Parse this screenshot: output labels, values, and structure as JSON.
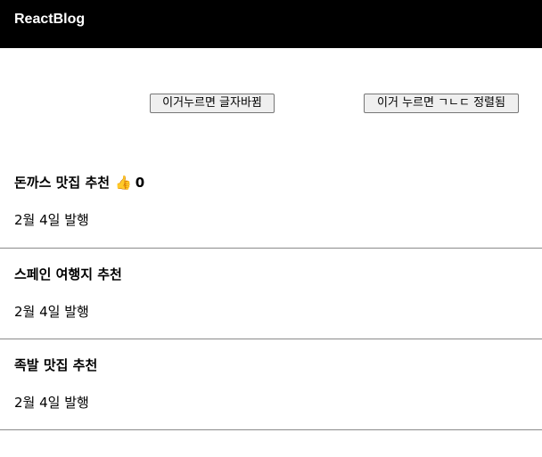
{
  "header": {
    "brand": "ReactBlog"
  },
  "controls": {
    "change_text_button": "이거누르면 글자바뀜",
    "sort_button": "이거 누르면 ㄱㄴㄷ 정렬됨"
  },
  "posts": [
    {
      "title": "돈까스 맛집 추천",
      "like_icon": "thumbs-up-icon",
      "likes": "0",
      "date": "2월 4일 발행"
    },
    {
      "title": "스페인 여행지 추천",
      "date": "2월 4일 발행"
    },
    {
      "title": "족발 맛집 추천",
      "date": "2월 4일 발행"
    }
  ]
}
